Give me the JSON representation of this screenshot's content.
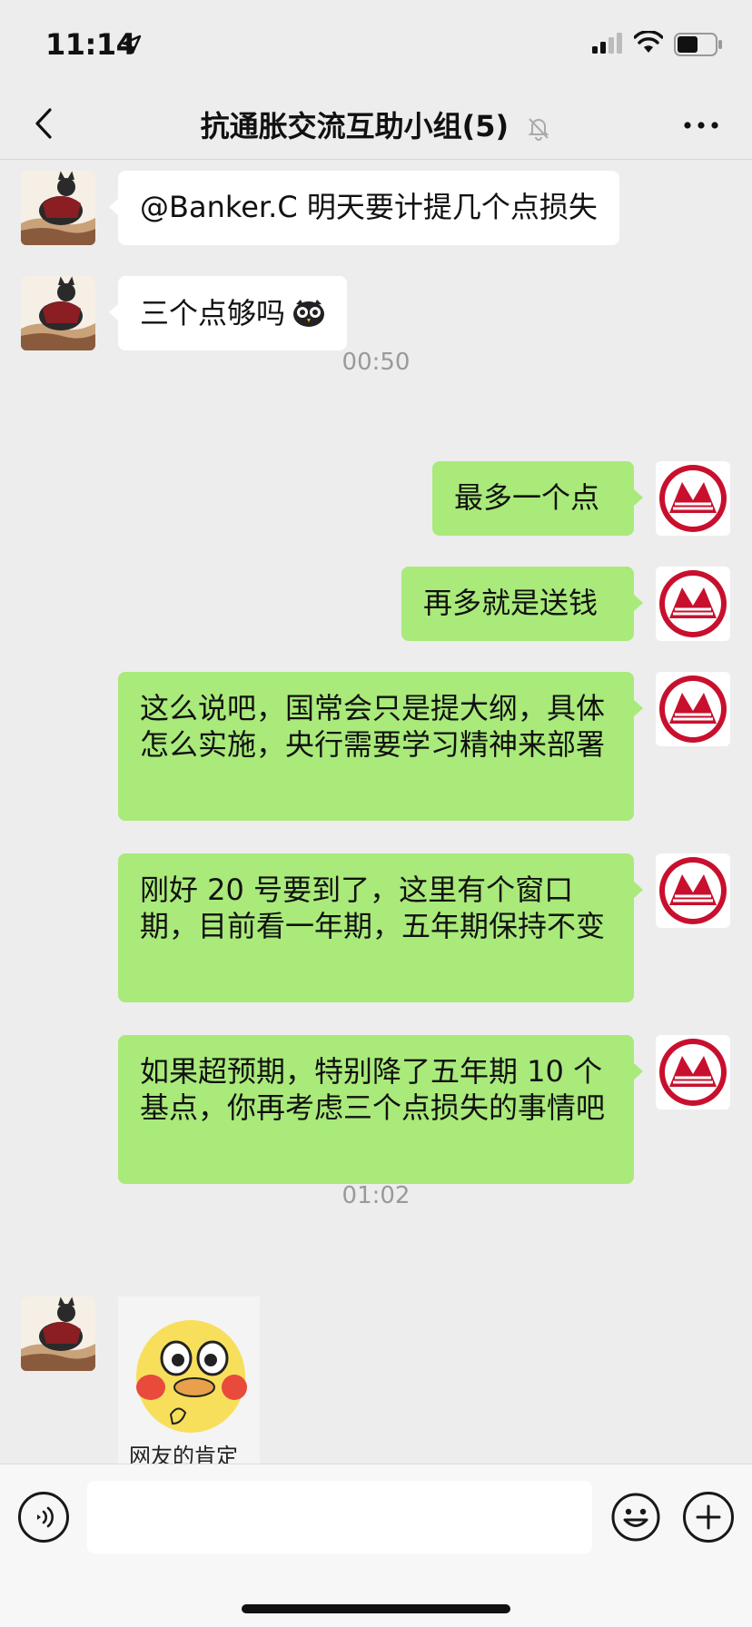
{
  "status_bar": {
    "time": "11:14"
  },
  "header": {
    "title": "抗通胀交流互助小组(5)"
  },
  "messages": {
    "m1": "@Banker.C 明天要计提几个点损失",
    "m2": "三个点够吗",
    "t1": "00:50",
    "m3": "最多一个点",
    "m4": "再多就是送钱",
    "m5": "这么说吧，国常会只是提大纲，具体怎么实施，央行需要学习精神来部署",
    "m6": "刚好 20 号要到了，这里有个窗口期，目前看一年期，五年期保持不变",
    "m7": "如果超预期，特别降了五年期 10 个基点，你再考虑三个点损失的事情吧",
    "t2": "01:02",
    "sticker_caption": "网友的肯定"
  },
  "input": {
    "value": "",
    "placeholder": ""
  },
  "colors": {
    "outgoing_bubble": "#a9ea7a",
    "incoming_bubble": "#ffffff",
    "background": "#ededed",
    "bank_logo": "#c8102e"
  },
  "icons": [
    "location-arrow-icon",
    "signal-icon",
    "wifi-icon",
    "battery-icon",
    "back-chevron-icon",
    "mute-bell-icon",
    "more-dots-icon",
    "owl-emoji-icon",
    "voice-icon",
    "emoji-face-icon",
    "plus-icon"
  ]
}
